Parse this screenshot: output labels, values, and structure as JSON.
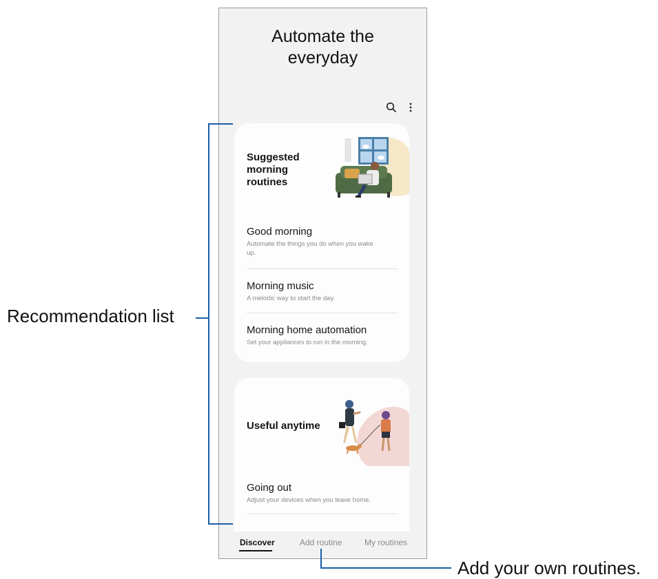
{
  "header": {
    "title_line1": "Automate the",
    "title_line2": "everyday"
  },
  "toolbar": {
    "search_icon": "search-icon",
    "more_icon": "more-vertical-icon"
  },
  "cards": [
    {
      "heading_lines": [
        "Suggested",
        "morning",
        "routines"
      ],
      "items": [
        {
          "title": "Good morning",
          "desc_line1": "Automate the things you do when you wake",
          "desc_line2": "up."
        },
        {
          "title": "Morning music",
          "desc_line1": "A melodic way to start the day."
        },
        {
          "title": "Morning home automation",
          "desc_line1": "Set your appliances to run in the morning."
        }
      ]
    },
    {
      "heading": "Useful anytime",
      "items": [
        {
          "title": "Going out",
          "desc_line1": "Adjust your devices when you leave home."
        }
      ]
    }
  ],
  "tabs": {
    "discover": "Discover",
    "add_routine": "Add routine",
    "my_routines": "My routines",
    "active": "Discover"
  },
  "callouts": {
    "recommendation_list": "Recommendation list",
    "add_own": "Add your own routines."
  },
  "colors": {
    "callout_line": "#1a5ea8",
    "screen_bg": "#f2f2f2",
    "card_bg": "#fdfdfd"
  }
}
